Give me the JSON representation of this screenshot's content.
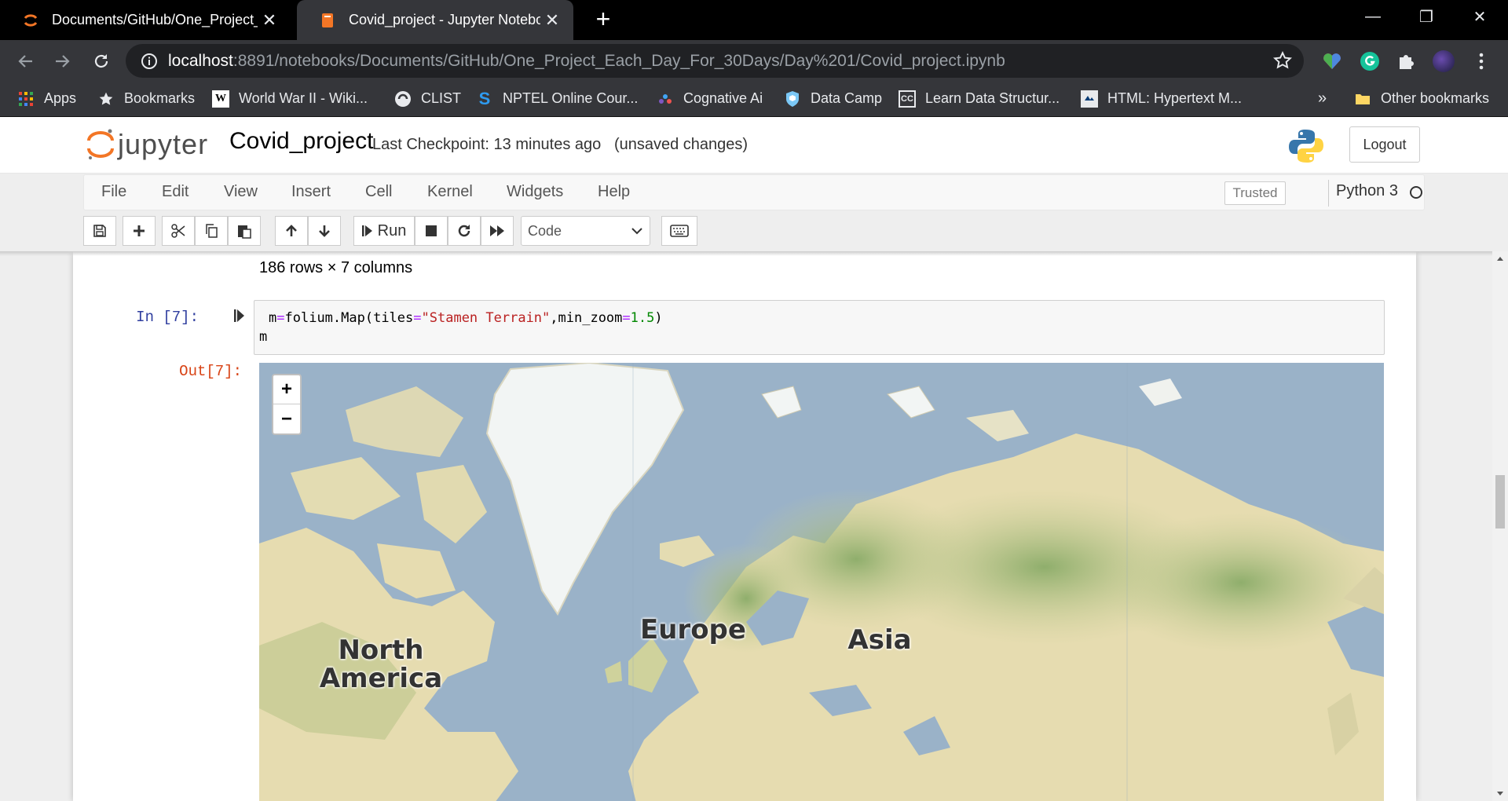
{
  "browser": {
    "tabs": [
      {
        "title": "Documents/GitHub/One_Project_",
        "close": "✕"
      },
      {
        "title": "Covid_project - Jupyter Notebook",
        "close": "✕"
      }
    ],
    "new_tab": "+",
    "window_controls": {
      "minimize": "—",
      "restore": "❐",
      "close": "✕"
    },
    "url_host": "localhost",
    "url_rest": ":8891/notebooks/Documents/GitHub/One_Project_Each_Day_For_30Days/Day%201/Covid_project.ipynb",
    "bookmarks": [
      {
        "label": "Apps",
        "icon": "apps-grid-icon"
      },
      {
        "label": "Bookmarks",
        "icon": "star-icon"
      },
      {
        "label": "World War II - Wiki...",
        "icon": "wikipedia-icon"
      },
      {
        "label": "CLIST",
        "icon": "clist-icon"
      },
      {
        "label": "NPTEL Online Cour...",
        "icon": "nptel-icon"
      },
      {
        "label": "Cognative Ai",
        "icon": "cognative-icon"
      },
      {
        "label": "Data Camp",
        "icon": "datacamp-icon"
      },
      {
        "label": "Learn Data Structur...",
        "icon": "cc-icon"
      },
      {
        "label": "HTML: Hypertext M...",
        "icon": "mdn-icon"
      }
    ],
    "more_bookmarks": "»",
    "other_bookmarks": "Other bookmarks"
  },
  "jupyter": {
    "logo_text": "jupyter",
    "notebook_name": "Covid_project",
    "checkpoint": "Last Checkpoint: 13 minutes ago",
    "unsaved": "(unsaved changes)",
    "logout": "Logout",
    "menu": [
      "File",
      "Edit",
      "View",
      "Insert",
      "Cell",
      "Kernel",
      "Widgets",
      "Help"
    ],
    "trusted": "Trusted",
    "kernel": "Python 3",
    "run_label": "Run",
    "cell_type": "Code"
  },
  "notebook": {
    "rows_note": "186 rows × 7 columns",
    "in_prompt": "In [7]:",
    "out_prompt": "Out[7]:",
    "code": {
      "line1_a": "m",
      "line1_op": "=",
      "line1_b": "folium.Map(tiles",
      "line1_op2": "=",
      "line1_str": "\"Stamen Terrain\"",
      "line1_c": ",min_zoom",
      "line1_op3": "=",
      "line1_num": "1.5",
      "line1_d": ")",
      "line2": "m"
    },
    "map": {
      "zoom_in": "+",
      "zoom_out": "−",
      "labels": {
        "north_america_1": "North",
        "north_america_2": "America",
        "europe": "Europe",
        "asia": "Asia"
      },
      "colors": {
        "water": "#9ab2c8",
        "land": "#e6dcb0",
        "forest": "#9fb67a",
        "ice": "#f4f7f7"
      }
    }
  }
}
